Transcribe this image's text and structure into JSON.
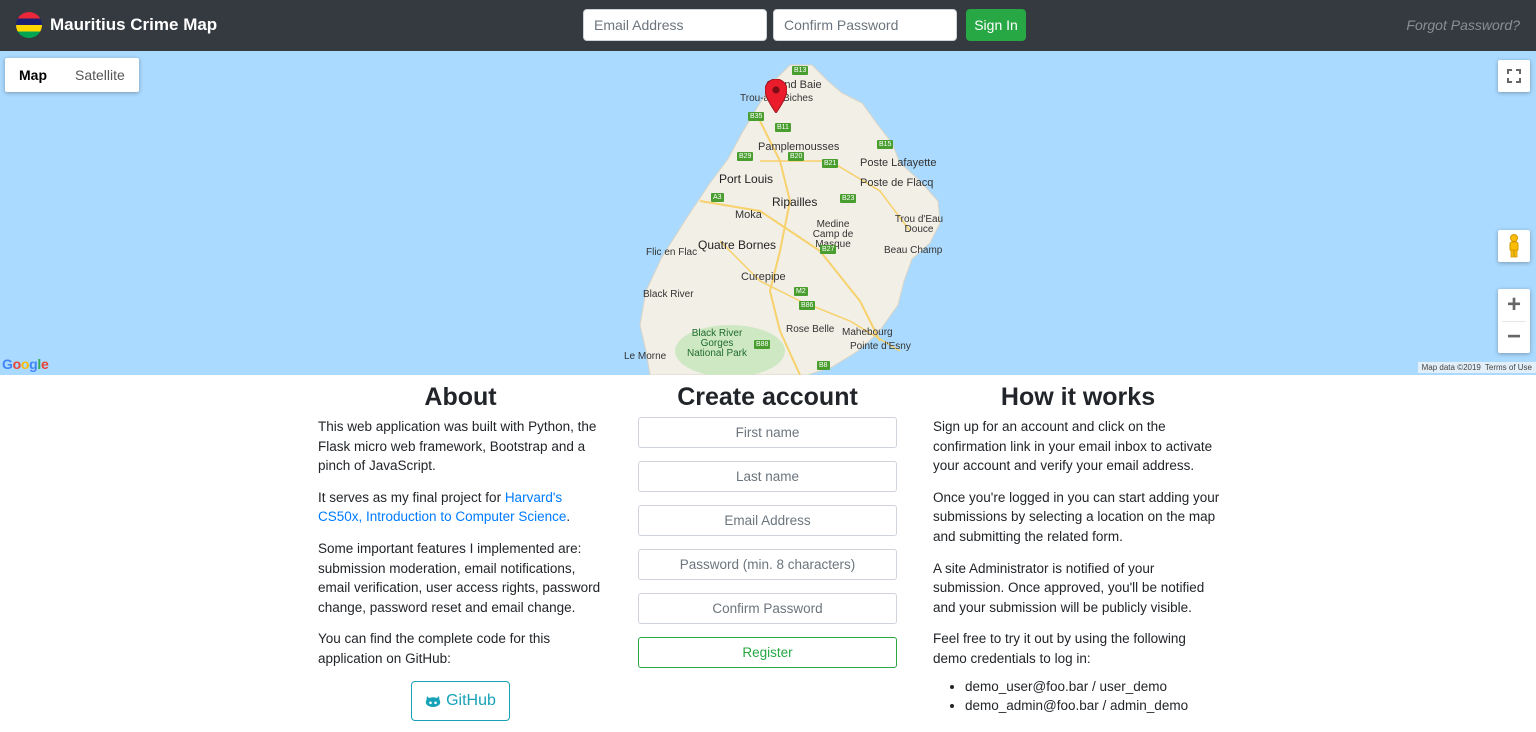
{
  "navbar": {
    "brand": "Mauritius Crime Map",
    "flag_colors": [
      "#EA2839",
      "#1A206D",
      "#FFD500",
      "#00A551"
    ],
    "email_placeholder": "Email Address",
    "password_placeholder": "Confirm Password",
    "signin_label": "Sign In",
    "forgot_label": "Forgot Password?"
  },
  "map": {
    "type_map": "Map",
    "type_satellite": "Satellite",
    "zoom_in": "+",
    "zoom_out": "−",
    "google": "Google",
    "attribution_data": "Map data ©2019",
    "attribution_terms": "Terms of Use",
    "places": {
      "grand_baie": "Grand Baie",
      "trou_aux_biches": "Trou-aux-Biches",
      "pamplemousses": "Pamplemousses",
      "poste_lafayette": "Poste Lafayette",
      "poste_de_flacq": "Poste de Flacq",
      "port_louis": "Port Louis",
      "ripailles": "Ripailles",
      "moka": "Moka",
      "medine": "Medine Camp de Masque",
      "trou_deau_douce": "Trou d'Eau Douce",
      "quatre_bornes": "Quatre Bornes",
      "flic_en_flac": "Flic en Flac",
      "beau_champ": "Beau Champ",
      "curepipe": "Curepipe",
      "black_river": "Black River",
      "gorges": "Black River Gorges National Park",
      "rose_belle": "Rose Belle",
      "mahebourg": "Mahebourg",
      "pointe_desny": "Pointe d'Esny",
      "le_morne": "Le Morne"
    },
    "roads": [
      "B13",
      "B35",
      "B11",
      "B29",
      "B20",
      "B21",
      "B15",
      "A3",
      "B23",
      "B27",
      "M2",
      "B86",
      "B88",
      "B8"
    ]
  },
  "about": {
    "heading": "About",
    "p1": "This web application was built with Python, the Flask micro web framework, Bootstrap and a pinch of JavaScript.",
    "p2_prefix": "It serves as my final project for ",
    "p2_link": "Harvard's CS50x, Introduction to Computer Science",
    "p2_suffix": ".",
    "p3": "Some important features I implemented are: submission moderation, email notifications, email verification, user access rights, password change, password reset and email change.",
    "p4": "You can find the complete code for this application on GitHub:",
    "github_label": "GitHub"
  },
  "create": {
    "heading": "Create account",
    "first_name": "First name",
    "last_name": "Last name",
    "email": "Email Address",
    "password": "Password (min. 8 characters)",
    "confirm": "Confirm Password",
    "register_label": "Register"
  },
  "how": {
    "heading": "How it works",
    "p1": "Sign up for an account and click on the confirmation link in your email inbox to activate your account and verify your email address.",
    "p2": "Once you're logged in you can start adding your submissions by selecting a location on the map and submitting the related form.",
    "p3": "A site Administrator is notified of your submission. Once approved, you'll be notified and your submission will be publicly visible.",
    "p4": "Feel free to try it out by using the following demo credentials to log in:",
    "credentials": [
      "demo_user@foo.bar / user_demo",
      "demo_admin@foo.bar / admin_demo"
    ]
  }
}
